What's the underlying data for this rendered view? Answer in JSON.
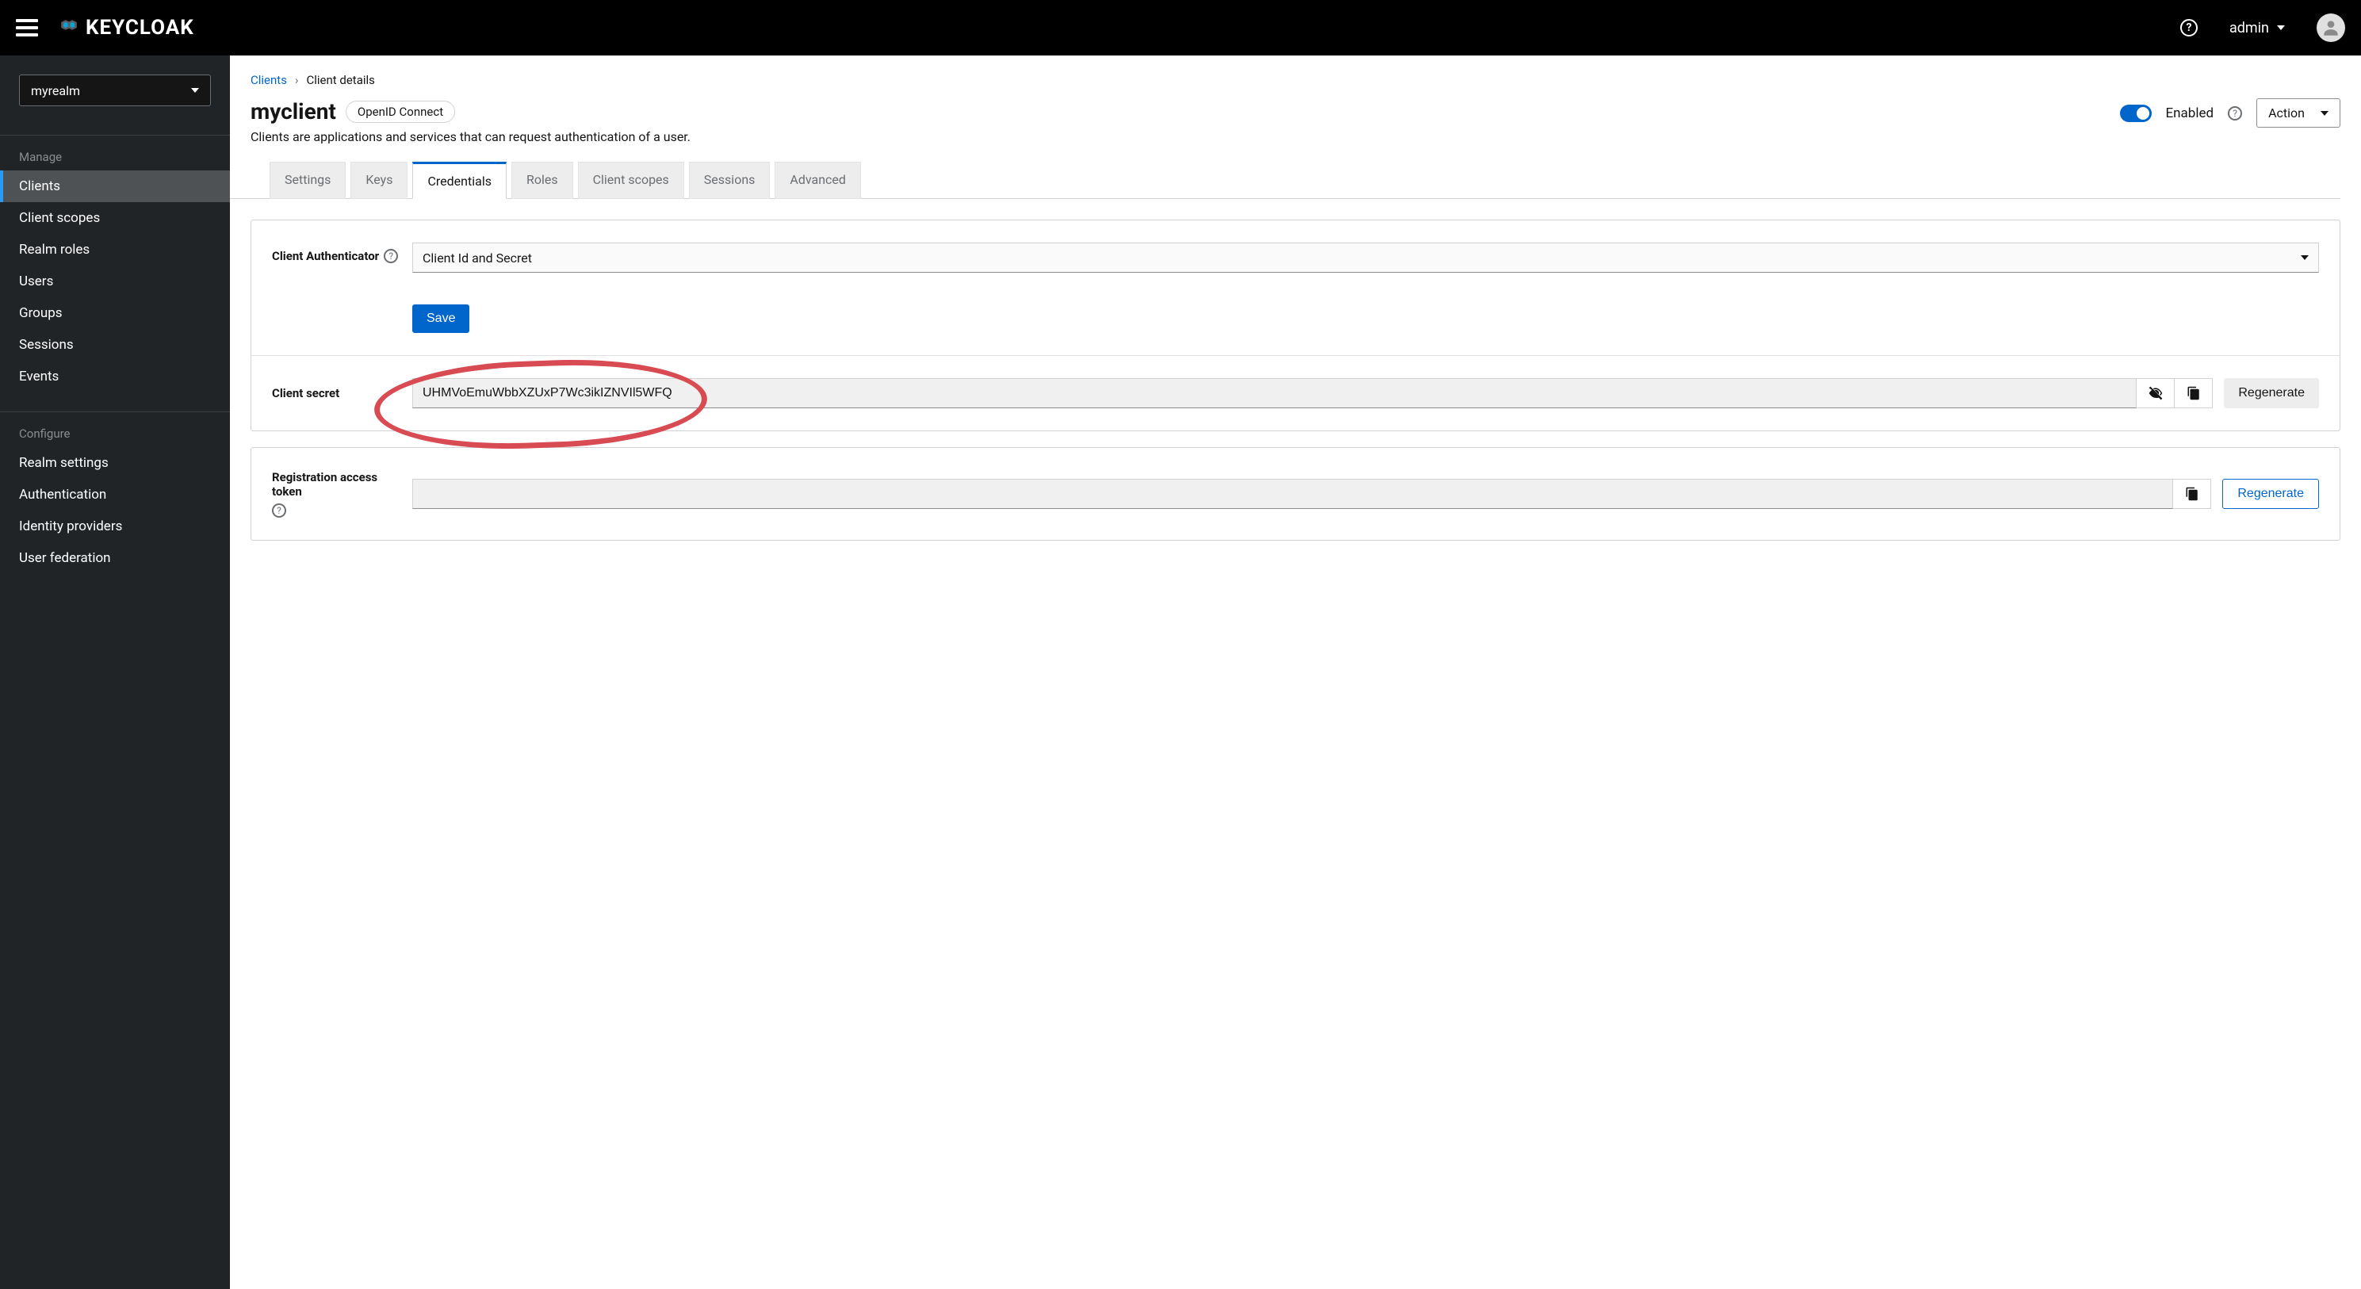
{
  "header": {
    "product_name": "KEYCLOAK",
    "username": "admin"
  },
  "sidebar": {
    "realm_selected": "myrealm",
    "section_manage": "Manage",
    "section_configure": "Configure",
    "manage_items": [
      {
        "id": "clients",
        "label": "Clients",
        "active": true
      },
      {
        "id": "client-scopes",
        "label": "Client scopes",
        "active": false
      },
      {
        "id": "realm-roles",
        "label": "Realm roles",
        "active": false
      },
      {
        "id": "users",
        "label": "Users",
        "active": false
      },
      {
        "id": "groups",
        "label": "Groups",
        "active": false
      },
      {
        "id": "sessions",
        "label": "Sessions",
        "active": false
      },
      {
        "id": "events",
        "label": "Events",
        "active": false
      }
    ],
    "configure_items": [
      {
        "id": "realm-settings",
        "label": "Realm settings"
      },
      {
        "id": "authentication",
        "label": "Authentication"
      },
      {
        "id": "identity-providers",
        "label": "Identity providers"
      },
      {
        "id": "user-federation",
        "label": "User federation"
      }
    ]
  },
  "breadcrumb": {
    "clients_label": "Clients",
    "current": "Client details"
  },
  "page": {
    "title": "myclient",
    "protocol": "OpenID Connect",
    "description": "Clients are applications and services that can request authentication of a user.",
    "enabled_label": "Enabled",
    "action_label": "Action"
  },
  "tabs": [
    {
      "id": "settings",
      "label": "Settings",
      "active": false
    },
    {
      "id": "keys",
      "label": "Keys",
      "active": false
    },
    {
      "id": "credentials",
      "label": "Credentials",
      "active": true
    },
    {
      "id": "roles",
      "label": "Roles",
      "active": false
    },
    {
      "id": "client-scopes",
      "label": "Client scopes",
      "active": false
    },
    {
      "id": "sessions",
      "label": "Sessions",
      "active": false
    },
    {
      "id": "advanced",
      "label": "Advanced",
      "active": false
    }
  ],
  "credentials": {
    "authenticator_label": "Client Authenticator",
    "authenticator_value": "Client Id and Secret",
    "save_label": "Save",
    "secret_label": "Client secret",
    "secret_value": "UHMVoEmuWbbXZUxP7Wc3ikIZNVIl5WFQ",
    "regenerate_label": "Regenerate",
    "registration_label": "Registration access token",
    "registration_value": ""
  }
}
